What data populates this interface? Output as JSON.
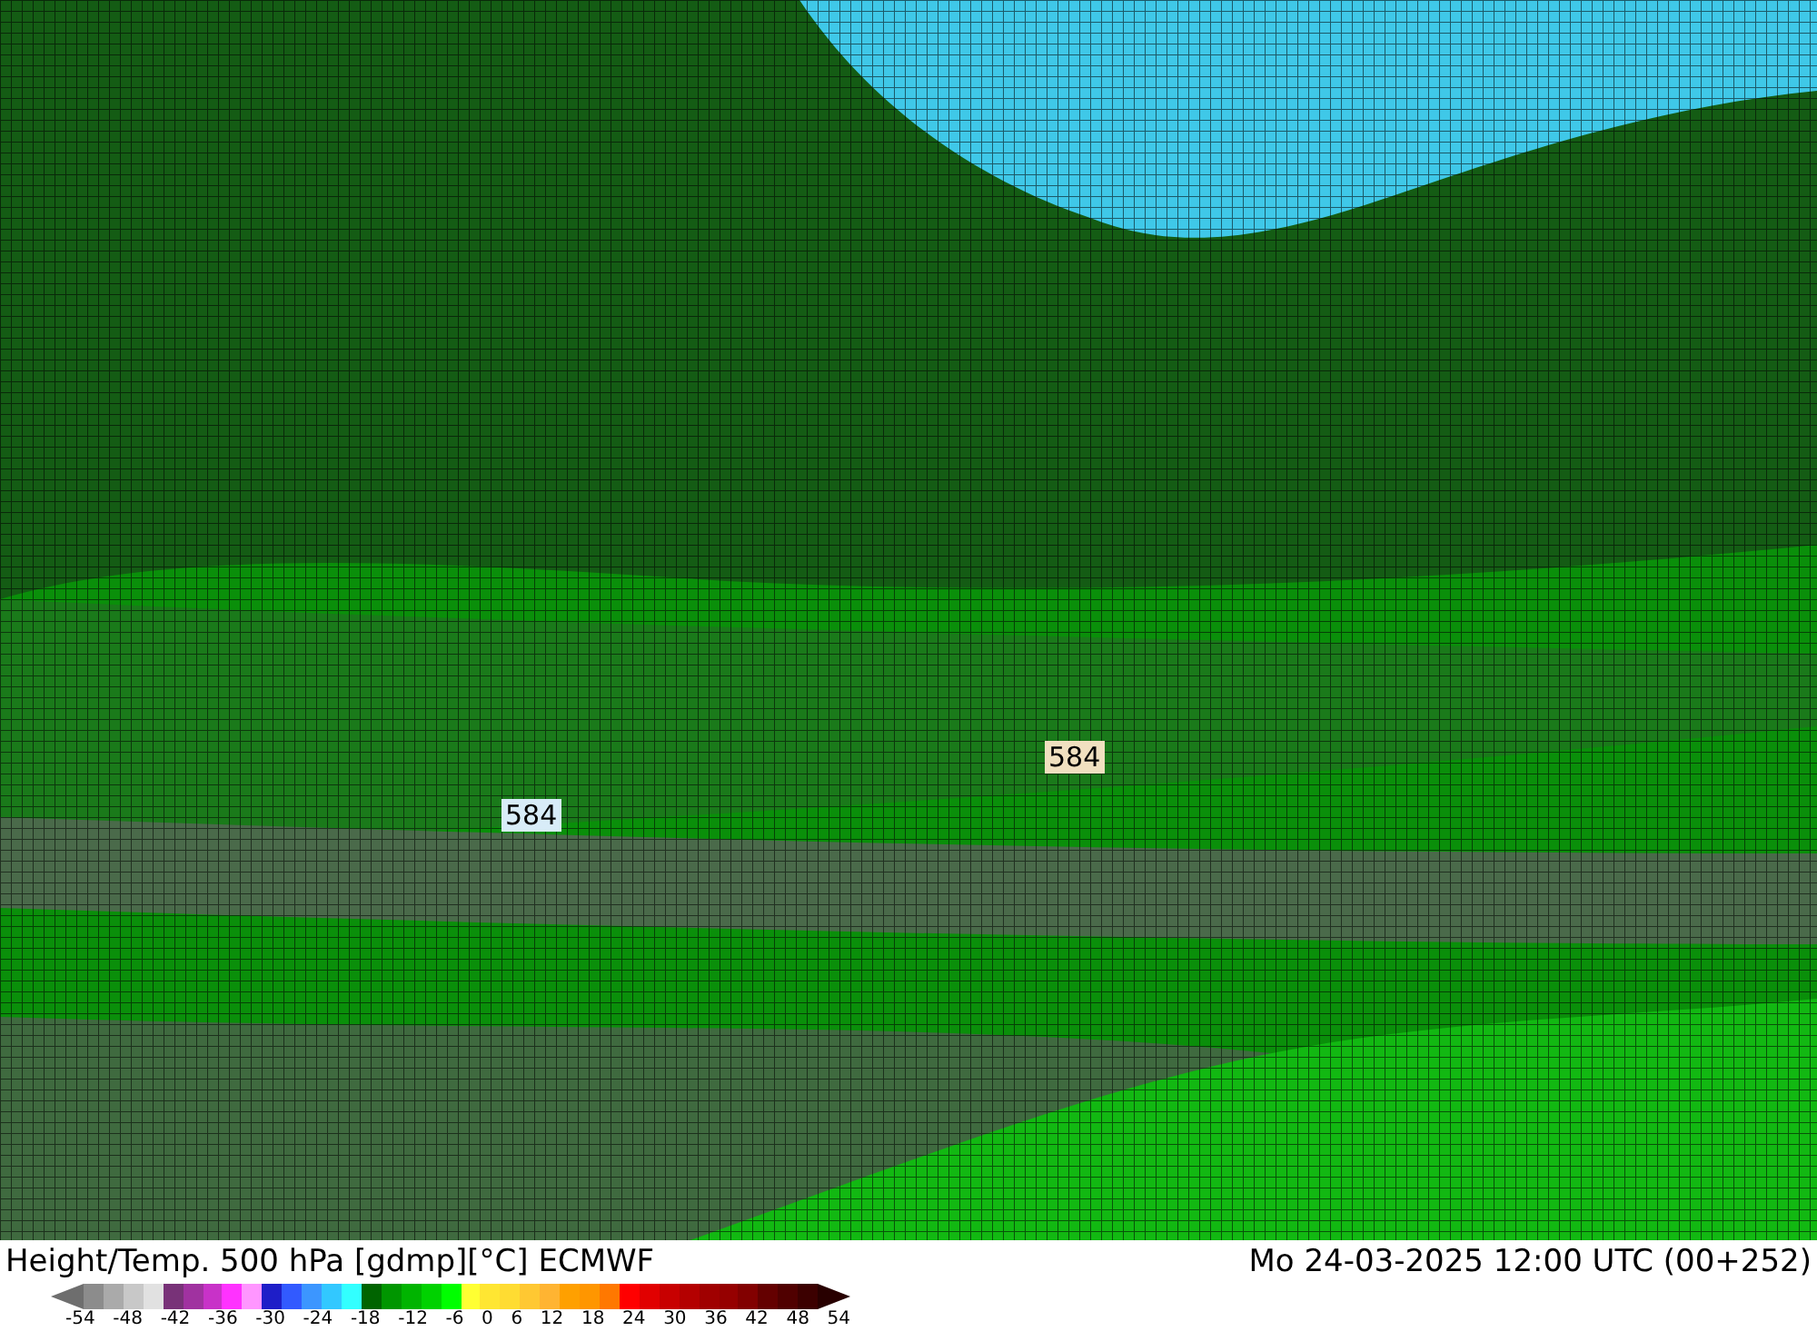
{
  "map": {
    "labels": [
      {
        "text": "584",
        "color": "#f0e0c0"
      },
      {
        "text": "584",
        "color": "#d8ecf8"
      }
    ]
  },
  "footer": {
    "title": "Height/Temp. 500 hPa [gdmp][°C] ECMWF",
    "datetime": "Mo 24-03-2025 12:00 UTC (00+252)"
  },
  "legend": {
    "swatches": [
      {
        "color": "#8c8c8c"
      },
      {
        "color": "#aaaaaa"
      },
      {
        "color": "#c8c8c8"
      },
      {
        "color": "#e1e1e1"
      },
      {
        "color": "#783278"
      },
      {
        "color": "#a032a0"
      },
      {
        "color": "#c832c8"
      },
      {
        "color": "#ff32ff"
      },
      {
        "color": "#ff96ff"
      },
      {
        "color": "#1e1ec8"
      },
      {
        "color": "#325aff"
      },
      {
        "color": "#3c96ff"
      },
      {
        "color": "#32c8ff"
      },
      {
        "color": "#32ffff"
      },
      {
        "color": "#006400"
      },
      {
        "color": "#009600"
      },
      {
        "color": "#00b400"
      },
      {
        "color": "#00d200"
      },
      {
        "color": "#00ff00"
      },
      {
        "color": "#ffff32"
      },
      {
        "color": "#ffe632"
      },
      {
        "color": "#ffdc32"
      },
      {
        "color": "#ffc832"
      },
      {
        "color": "#ffb432"
      },
      {
        "color": "#ffa000"
      },
      {
        "color": "#ff9600"
      },
      {
        "color": "#ff7800"
      },
      {
        "color": "#ff0000"
      },
      {
        "color": "#e10000"
      },
      {
        "color": "#c80000"
      },
      {
        "color": "#b40000"
      },
      {
        "color": "#a00000"
      },
      {
        "color": "#960000"
      },
      {
        "color": "#820000"
      },
      {
        "color": "#640000"
      },
      {
        "color": "#500000"
      },
      {
        "color": "#3c0000"
      }
    ],
    "ticks": [
      "-54",
      "-48",
      "-42",
      "-36",
      "-30",
      "-24",
      "-18",
      "-12",
      "-6",
      "0",
      "6",
      "12",
      "18",
      "24",
      "30",
      "36",
      "42",
      "48",
      "54"
    ]
  }
}
